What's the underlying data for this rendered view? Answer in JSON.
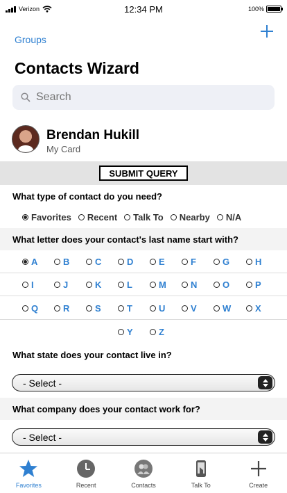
{
  "status": {
    "carrier": "Verizon",
    "time": "12:34 PM",
    "battery": "100%",
    "battery_level": 1.0
  },
  "nav": {
    "back_label": "Groups",
    "add_icon": "plus-icon"
  },
  "title": "Contacts Wizard",
  "search": {
    "placeholder": "Search"
  },
  "profile": {
    "name": "Brendan Hukill",
    "subtitle": "My Card"
  },
  "submit_label": "SUBMIT QUERY",
  "q1": {
    "question": "What type of contact do you need?",
    "options": [
      "Favorites",
      "Recent",
      "Talk To",
      "Nearby",
      "N/A"
    ],
    "selected": "Favorites"
  },
  "q2": {
    "question": "What letter does your contact's last name start with?",
    "rows": [
      [
        "A",
        "B",
        "C",
        "D",
        "E",
        "F",
        "G",
        "H"
      ],
      [
        "I",
        "J",
        "K",
        "L",
        "M",
        "N",
        "O",
        "P"
      ],
      [
        "Q",
        "R",
        "S",
        "T",
        "U",
        "V",
        "W",
        "X"
      ],
      [
        "Y",
        "Z"
      ]
    ],
    "selected": "A"
  },
  "q3": {
    "question": "What state does your contact live in?",
    "value": "- Select -"
  },
  "q4": {
    "question": "What company does your contact work for?",
    "value": "- Select -"
  },
  "tabs": [
    {
      "label": "Favorites",
      "icon": "star-icon",
      "active": true
    },
    {
      "label": "Recent",
      "icon": "clock-icon",
      "active": false
    },
    {
      "label": "Contacts",
      "icon": "contacts-icon",
      "active": false
    },
    {
      "label": "Talk To",
      "icon": "phone-icon",
      "active": false
    },
    {
      "label": "Create",
      "icon": "plus-icon",
      "active": false
    }
  ],
  "colors": {
    "accent": "#2f80d1",
    "divider": "#e3e3e3"
  }
}
